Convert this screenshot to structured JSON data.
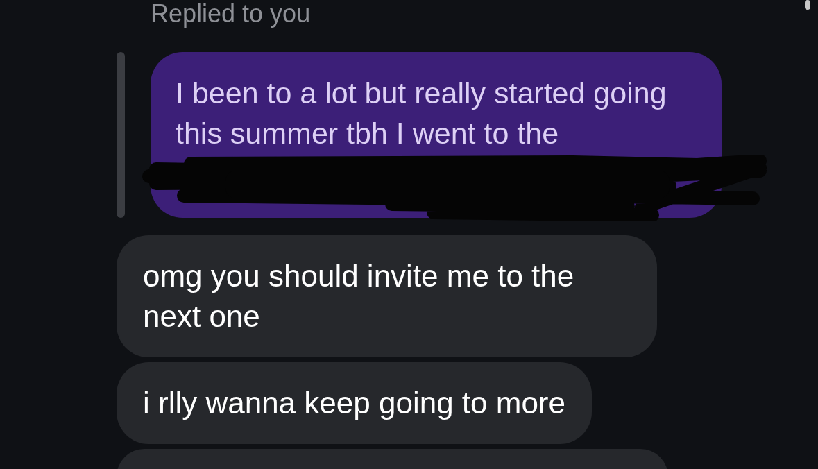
{
  "reply_label": "Replied to you",
  "quoted_message": {
    "lines": [
      "I been to a lot but really started going",
      "this summer tbh I went to the"
    ],
    "redacted": true
  },
  "messages": [
    {
      "text": "omg you should invite me to the next one"
    },
    {
      "text": "i rlly wanna keep going to more"
    }
  ],
  "more_below": true
}
